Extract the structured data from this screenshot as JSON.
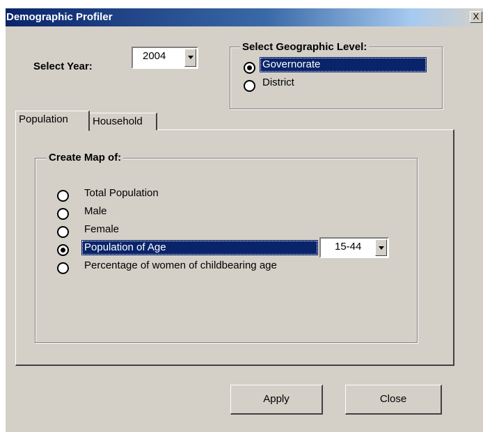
{
  "window": {
    "title": "Demographic Profiler",
    "close_label": "X"
  },
  "year": {
    "label": "Select Year:",
    "value": "2004"
  },
  "geo_level": {
    "legend": "Select Geographic Level:",
    "options": [
      {
        "label": "Governorate",
        "checked": true
      },
      {
        "label": "District",
        "checked": false
      }
    ]
  },
  "tabs": [
    {
      "label": "Population",
      "active": true
    },
    {
      "label": "Household",
      "active": false
    }
  ],
  "map_group": {
    "legend": "Create Map of:",
    "options": [
      {
        "label": "Total Population",
        "checked": false
      },
      {
        "label": "Male",
        "checked": false
      },
      {
        "label": "Female",
        "checked": false
      },
      {
        "label": "Population of Age",
        "checked": true
      },
      {
        "label": "Percentage of women of childbearing age",
        "checked": false
      }
    ],
    "age_range": "15-44"
  },
  "buttons": {
    "apply": "Apply",
    "close": "Close"
  },
  "colors": {
    "face": "#d4d0c8",
    "title_start": "#0a246a",
    "selection": "#0a246a"
  }
}
